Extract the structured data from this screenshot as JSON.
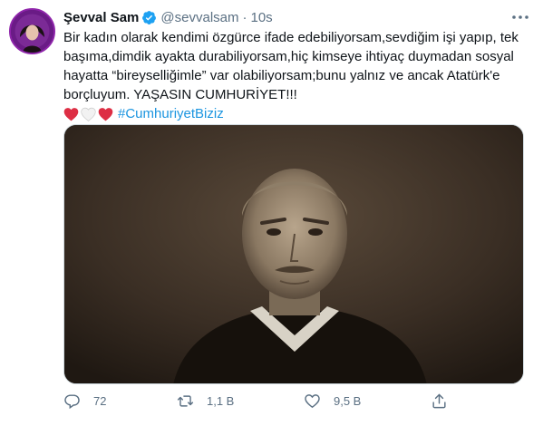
{
  "user": {
    "name": "Şevval Sam",
    "handle": "@sevvalsam",
    "separator": "·",
    "time": "10s",
    "verified": true
  },
  "tweet": {
    "lines": [
      "Bir kadın olarak kendimi özgürce ifade edebiliyorsam,sevdiğim işi yapıp, tek",
      "başıma,dimdik ayakta durabiliyorsam,hiç kimseye ihtiyaç duymadan sosyal",
      "hayatta “bireyselliğimle” var olabiliyorsam;bunu yalnız ve ancak Atatürk'e",
      "borçluyum. YAŞASIN CUMHURİYET!!!"
    ],
    "emojis": [
      "red-heart",
      "white-heart",
      "red-heart"
    ],
    "hashtag": "#CumhuriyetBiziz"
  },
  "actions": {
    "reply_count": "72",
    "retweet_count": "1,1 B",
    "like_count": "9,5 B"
  },
  "colors": {
    "accent": "#1b95e0",
    "verified": "#1da1f2",
    "muted": "#5b7083",
    "heart_red": "#dd2e44"
  }
}
